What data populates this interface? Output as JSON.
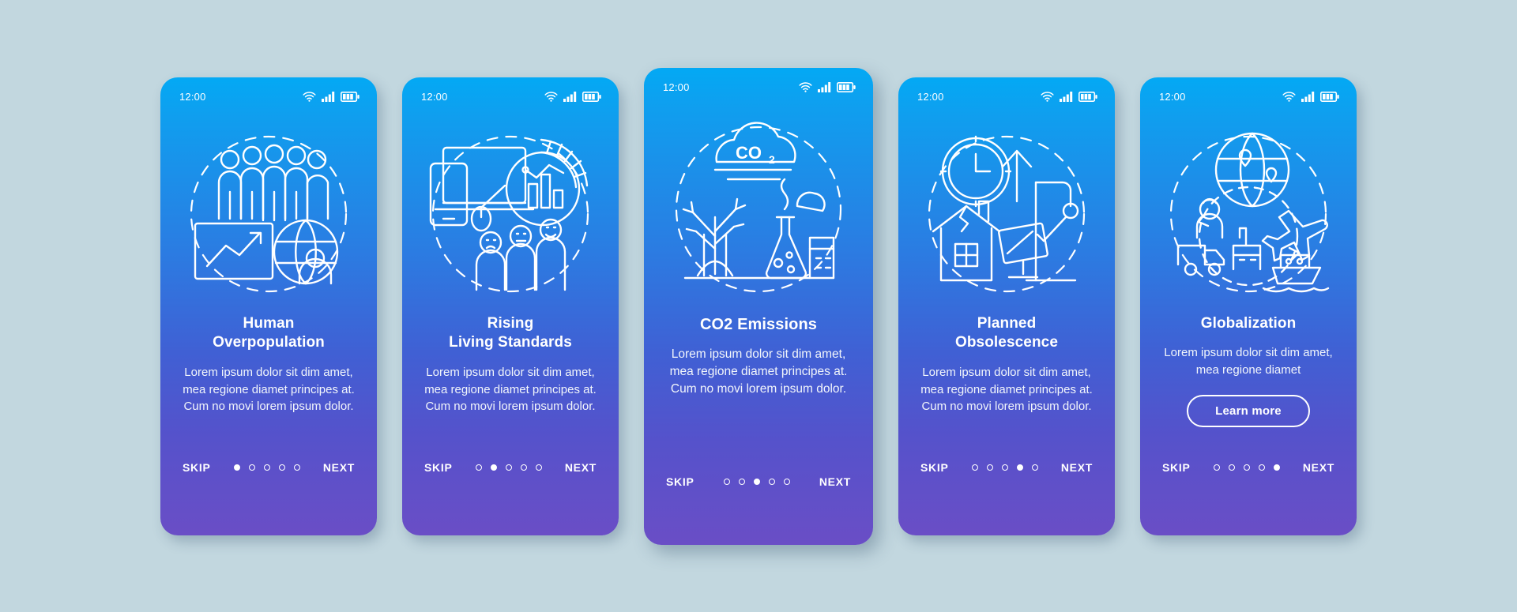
{
  "background_color": "#c2d7df",
  "card_gradient": {
    "from": "#03a9f4",
    "mid": "#3a66d7",
    "to": "#6a4ec6"
  },
  "status_bar": {
    "time": "12:00",
    "icons": [
      "wifi-icon",
      "cellular-signal-icon",
      "battery-icon"
    ]
  },
  "nav": {
    "skip_label": "SKIP",
    "next_label": "NEXT",
    "total_steps": 5
  },
  "screens": [
    {
      "id": "human-overpopulation",
      "illustration": "crowd-chart-globe-icon",
      "title": "Human\nOverpopulation",
      "body": "Lorem ipsum dolor sit dim amet, mea regione diamet principes at. Cum no movi lorem ipsum dolor.",
      "active_step": 1,
      "featured": false,
      "cta": null
    },
    {
      "id": "rising-living-standards",
      "illustration": "devices-donut-chart-people-icon",
      "title": "Rising\nLiving Standards",
      "body": "Lorem ipsum dolor sit dim amet, mea regione diamet principes at. Cum no movi lorem ipsum dolor.",
      "active_step": 2,
      "featured": false,
      "cta": null
    },
    {
      "id": "co2-emissions",
      "illustration": "co2-cloud-tree-factory-icon",
      "title": "CO2 Emissions",
      "body": "Lorem ipsum dolor sit dim amet, mea regione diamet principes at. Cum no movi lorem ipsum dolor.",
      "active_step": 3,
      "featured": true,
      "cta": null
    },
    {
      "id": "planned-obsolescence",
      "illustration": "clock-house-factory-arm-icon",
      "title": "Planned\nObsolescence",
      "body": "Lorem ipsum dolor sit dim amet, mea regione diamet principes at. Cum no movi lorem ipsum dolor.",
      "active_step": 4,
      "featured": false,
      "cta": null
    },
    {
      "id": "globalization",
      "illustration": "globe-transport-logistics-icon",
      "title": "Globalization",
      "body": "Lorem ipsum dolor sit dim amet, mea regione diamet",
      "active_step": 5,
      "featured": false,
      "cta": "Learn more"
    }
  ]
}
